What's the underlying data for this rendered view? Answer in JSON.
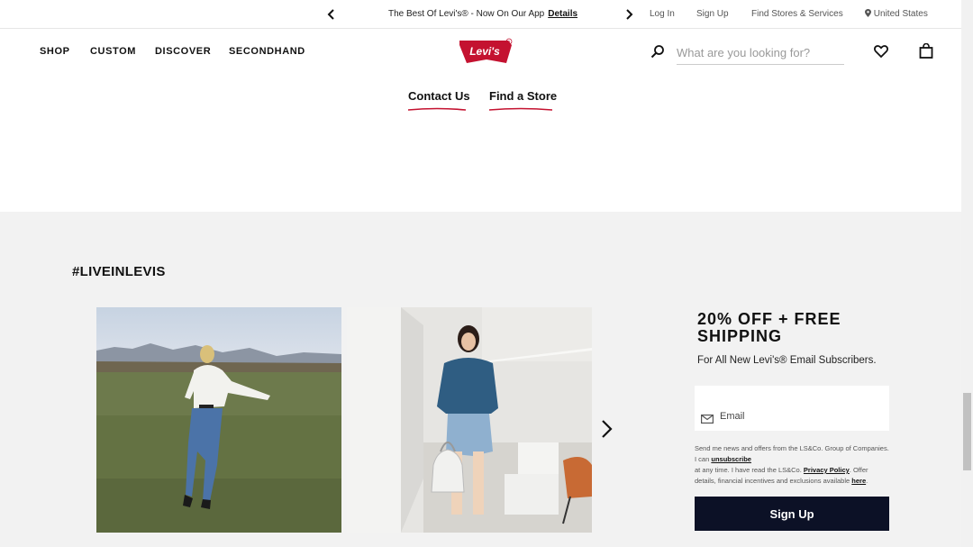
{
  "promo": {
    "text": "The Best Of Levi's® - Now On Our App",
    "link": "Details"
  },
  "utility": {
    "login": "Log In",
    "signup": "Sign Up",
    "stores": "Find Stores & Services",
    "region": "United States"
  },
  "nav": {
    "items": [
      "SHOP",
      "CUSTOM",
      "DISCOVER",
      "SECONDHAND"
    ],
    "logo_text": "Levi's",
    "search_placeholder": "What are you looking for?"
  },
  "help": {
    "contact": "Contact Us",
    "store": "Find a Store"
  },
  "liveinlevis": {
    "hashtag": "#LIVEINLEVIS"
  },
  "newsletter": {
    "title": "20% OFF + FREE SHIPPING",
    "subtitle": "For All New Levi's® Email Subscribers.",
    "email_placeholder": "Email",
    "legal_1": "Send me news and offers from the LS&Co. Group of Companies. I can",
    "legal_unsub": "unsubscribe",
    "legal_2": "at any time. I have read the LS&Co.",
    "legal_privacy": "Privacy Policy",
    "legal_3": ". Offer details, financial incentives and exclusions available",
    "legal_here": "here",
    "legal_4": ".",
    "button": "Sign Up"
  },
  "colors": {
    "accent": "#c41230",
    "button_bg": "#0c1126",
    "section_bg": "#f2f2f2"
  }
}
